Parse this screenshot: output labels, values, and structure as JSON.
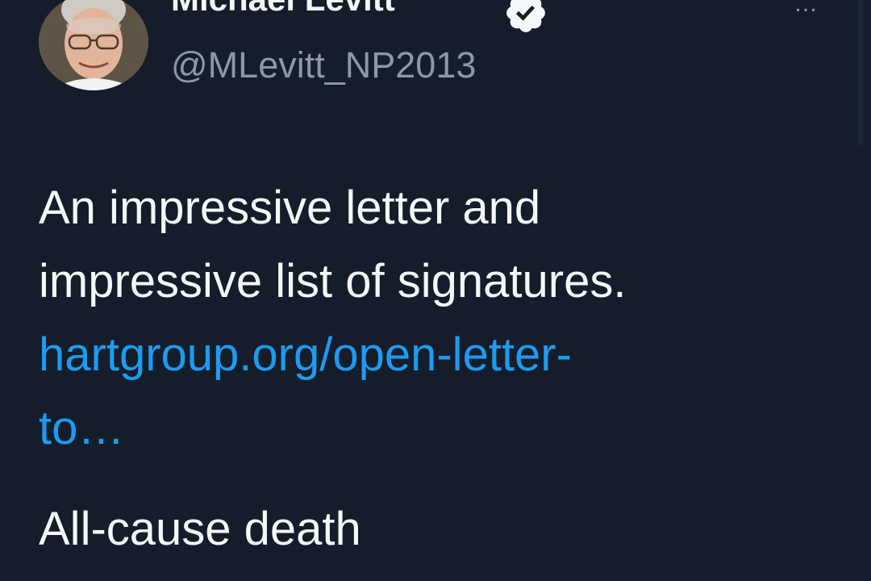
{
  "author": {
    "display_name": "Michael Levitt",
    "handle": "@MLevitt_NP2013",
    "verified": true
  },
  "menu": {
    "more_label": "…"
  },
  "tweet": {
    "line1": "An impressive letter and",
    "line2": "impressive list of signatures.",
    "link_line1": "hartgroup.org/open-letter-",
    "link_line2": "to…",
    "line3": "All-cause death"
  },
  "colors": {
    "background": "#151d2a",
    "text": "#f5f8fa",
    "secondary": "#8b98a5",
    "link": "#1d9bf0"
  }
}
